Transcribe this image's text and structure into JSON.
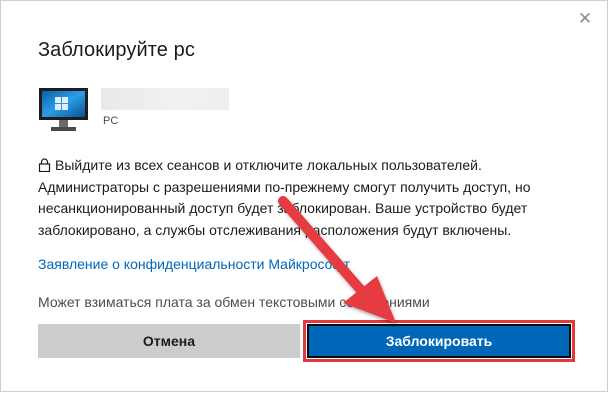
{
  "dialog": {
    "title": "Заблокируйте pc",
    "close_glyph": "✕",
    "device_type": "PC",
    "description": "Выйдите из всех сеансов и отключите локальных пользователей. Администраторы с разрешениями по-прежнему смогут получить доступ, но несанкционированный доступ будет заблокирован. Ваше устройство будет заблокировано, а службы отслеживания расположения будут включены.",
    "privacy_link": "Заявление о конфиденциальности Майкрософт",
    "sms_note": "Может взиматься плата за обмен текстовыми сообщениями",
    "cancel_label": "Отмена",
    "lock_label": "Заблокировать"
  },
  "colors": {
    "link": "#0067b8",
    "primary_button": "#0067b8",
    "cancel_button": "#cccccc",
    "annotation_red": "#e0393e"
  },
  "icons": {
    "close": "close-icon",
    "device": "monitor-icon",
    "lock": "lock-icon",
    "annotation": "red-arrow-icon"
  }
}
